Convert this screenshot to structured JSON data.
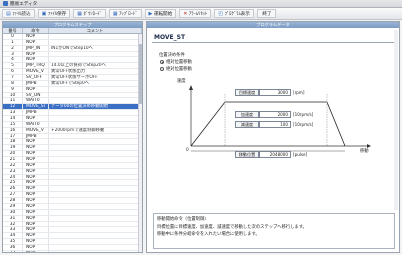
{
  "window": {
    "title": "簡易エディタ"
  },
  "toolbar": {
    "items": [
      {
        "icon": "open-file-icon",
        "label": "ﾌｧｲﾙ読込"
      },
      {
        "icon": "save-icon",
        "label": "ﾌｧｲﾙ保存"
      },
      {
        "icon": "upload-icon",
        "label": "ﾀﾞｳﾝﾛｰﾄﾞ"
      },
      {
        "icon": "download-icon",
        "label": "ｱｯﾌﾟﾛｰﾄﾞ"
      },
      {
        "icon": "play-icon",
        "label": "運転開始"
      },
      {
        "icon": "stop-icon",
        "label": "ｱﾗｰﾑﾘｾｯﾄ"
      },
      {
        "icon": "monitor-icon",
        "label": "ﾌﾟﾛｸﾞﾗﾑ表示"
      },
      {
        "icon": "exit-icon",
        "label": "終了"
      }
    ]
  },
  "left": {
    "header": "プログラムステップ",
    "columns": [
      "番号",
      "命令",
      "コメント"
    ],
    "rows": [
      {
        "no": "0",
        "cmd": "NOP",
        "comment": ""
      },
      {
        "no": "1",
        "cmd": "NOP",
        "comment": ""
      },
      {
        "no": "2",
        "cmd": "JMP_IN",
        "comment": "IN1がONでStep10へ"
      },
      {
        "no": "3",
        "cmd": "NOP",
        "comment": ""
      },
      {
        "no": "4",
        "cmd": "NOP",
        "comment": ""
      },
      {
        "no": "5",
        "cmd": "JMP_TRQ",
        "comment": "14.0以上の負荷でStep20へ"
      },
      {
        "no": "6",
        "cmd": "MOVE_V",
        "comment": "異常OFF状態出力"
      },
      {
        "no": "7",
        "cmd": "SV_OFF",
        "comment": "異常OFF状態サーボOFF"
      },
      {
        "no": "8",
        "cmd": "JMPB",
        "comment": "異常OFFでStep0へ"
      },
      {
        "no": "9",
        "cmd": "NOP",
        "comment": ""
      },
      {
        "no": "10",
        "cmd": "SV_ON",
        "comment": ""
      },
      {
        "no": "11",
        "cmd": "WAIT0",
        "comment": ""
      },
      {
        "no": "12",
        "cmd": "MOVE_ST",
        "comment": "データ00の位置決め移動開始"
      },
      {
        "no": "13",
        "cmd": "JMPB",
        "comment": ""
      },
      {
        "no": "14",
        "cmd": "NOP",
        "comment": ""
      },
      {
        "no": "15",
        "cmd": "WAIT0",
        "comment": ""
      },
      {
        "no": "16",
        "cmd": "MOVE_V",
        "comment": "+2000rpmで速度制御移動"
      },
      {
        "no": "17",
        "cmd": "JMPB",
        "comment": ""
      },
      {
        "no": "18",
        "cmd": "NOP",
        "comment": ""
      },
      {
        "no": "19",
        "cmd": "NOP",
        "comment": ""
      },
      {
        "no": "20",
        "cmd": "NOP",
        "comment": ""
      },
      {
        "no": "21",
        "cmd": "NOP",
        "comment": ""
      },
      {
        "no": "22",
        "cmd": "NOP",
        "comment": ""
      },
      {
        "no": "23",
        "cmd": "NOP",
        "comment": ""
      },
      {
        "no": "24",
        "cmd": "NOP",
        "comment": ""
      },
      {
        "no": "25",
        "cmd": "NOP",
        "comment": ""
      },
      {
        "no": "26",
        "cmd": "NOP",
        "comment": ""
      },
      {
        "no": "27",
        "cmd": "NOP",
        "comment": ""
      },
      {
        "no": "28",
        "cmd": "NOP",
        "comment": ""
      },
      {
        "no": "29",
        "cmd": "NOP",
        "comment": ""
      },
      {
        "no": "30",
        "cmd": "NOP",
        "comment": ""
      },
      {
        "no": "31",
        "cmd": "NOP",
        "comment": ""
      },
      {
        "no": "32",
        "cmd": "NOP",
        "comment": ""
      },
      {
        "no": "33",
        "cmd": "NOP",
        "comment": ""
      },
      {
        "no": "34",
        "cmd": "NOP",
        "comment": ""
      },
      {
        "no": "35",
        "cmd": "NOP",
        "comment": ""
      },
      {
        "no": "36",
        "cmd": "NOP",
        "comment": ""
      },
      {
        "no": "37",
        "cmd": "NOP",
        "comment": ""
      }
    ],
    "selected_index": 12
  },
  "right": {
    "header": "プログラムデータ",
    "command": "MOVE_ST",
    "condition_label": "位置決め条件",
    "radios": [
      {
        "label": "相対位置移動",
        "checked": true
      },
      {
        "label": "絶対位置移動",
        "checked": false
      }
    ],
    "axis_speed": "速度",
    "axis_move": "移動",
    "origin": "0",
    "fields": [
      {
        "label": "目標速度",
        "value": "3000",
        "unit": "[rpm]"
      },
      {
        "label": "加速度",
        "value": "2000",
        "unit": "[10rpm/s]"
      },
      {
        "label": "減速度",
        "value": "100",
        "unit": "[10rpm/s]"
      },
      {
        "label": "移動位置",
        "value": "2048000",
        "unit": "[pulse]"
      }
    ],
    "description": [
      "移動開始命令（位置制御）",
      "目標位置に目標速度、加速度、減速度で移動した次のステップへ移行します。",
      "移動中に条件分岐命令を入れたい場合に使用します。"
    ]
  },
  "colors": {
    "accent": "#3b6fc4",
    "header_band": "#7b9cc4"
  }
}
